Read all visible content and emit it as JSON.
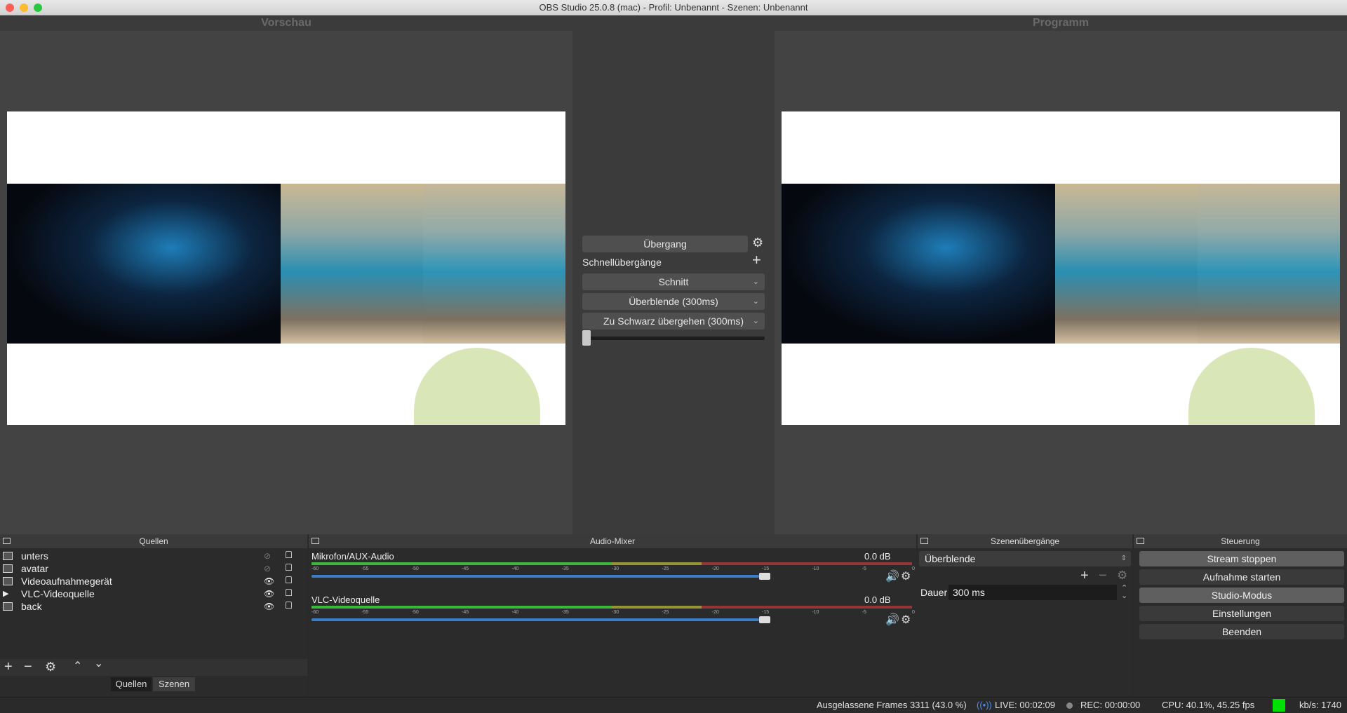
{
  "window": {
    "title": "OBS Studio 25.0.8 (mac) - Profil: Unbenannt - Szenen: Unbenannt"
  },
  "preview": {
    "title": "Vorschau"
  },
  "program": {
    "title": "Programm"
  },
  "transitions_panel": {
    "transition_button": "Übergang",
    "quick_label": "Schnellübergänge",
    "quick": [
      "Schnitt",
      "Überblende (300ms)",
      "Zu Schwarz übergehen (300ms)"
    ],
    "tbar_position": 0.0
  },
  "sources": {
    "title": "Quellen",
    "items": [
      {
        "name": "unters",
        "icon": "image-icon",
        "visible": false
      },
      {
        "name": "avatar",
        "icon": "image-icon",
        "visible": false
      },
      {
        "name": "Videoaufnahmegerät",
        "icon": "camera-icon",
        "visible": true
      },
      {
        "name": "VLC-Videoquelle",
        "icon": "play-icon",
        "visible": true
      },
      {
        "name": "back",
        "icon": "image-icon",
        "visible": true
      }
    ],
    "tabs": [
      "Quellen",
      "Szenen"
    ]
  },
  "mixer": {
    "title": "Audio-Mixer",
    "channels": [
      {
        "name": "Mikrofon/AUX-Audio",
        "db": "0.0 dB",
        "level": 0.99
      },
      {
        "name": "VLC-Videoquelle",
        "db": "0.0 dB",
        "level": 0.99
      }
    ],
    "scale": [
      "-60",
      "-55",
      "-50",
      "-45",
      "-40",
      "-35",
      "-30",
      "-25",
      "-20",
      "-15",
      "-10",
      "-5",
      "0"
    ]
  },
  "scene_transitions": {
    "title": "Szenenübergänge",
    "selected": "Überblende",
    "duration_label": "Dauer",
    "duration_value": "300 ms"
  },
  "controls": {
    "title": "Steuerung",
    "buttons": [
      "Stream stoppen",
      "Aufnahme starten",
      "Studio-Modus",
      "Einstellungen",
      "Beenden"
    ]
  },
  "status": {
    "dropped": "Ausgelassene Frames 3311 (43.0 %)",
    "live": "LIVE: 00:02:09",
    "rec": "REC: 00:00:00",
    "cpu": "CPU: 40.1%, 45.25 fps",
    "kbs": "kb/s: 1740",
    "health_color": "#00e000"
  }
}
